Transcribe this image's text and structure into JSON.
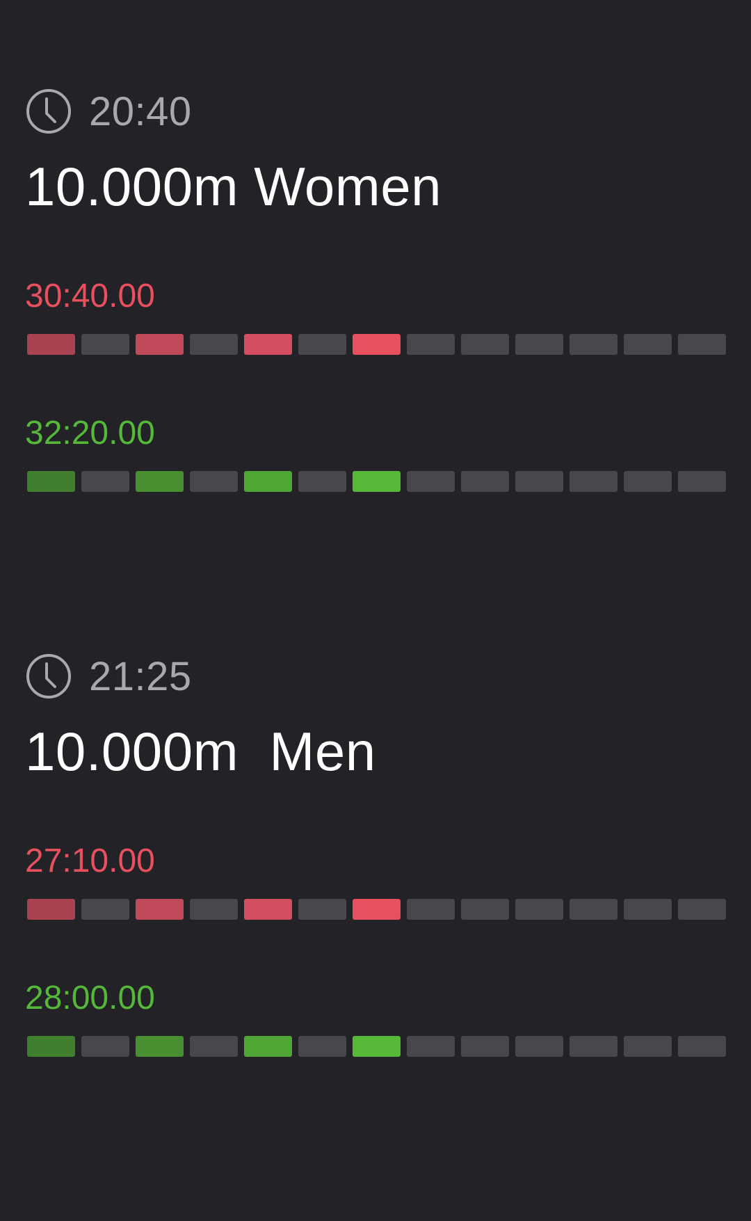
{
  "colors": {
    "background": "#232227",
    "time_text": "#a9a9ad",
    "off_segment": "#48474d",
    "red_text": "#e8505f",
    "green_text": "#55b83b",
    "red_steps": [
      "#a9434f",
      "#c0495a",
      "#d34e5f",
      "#e8505f"
    ],
    "green_steps": [
      "#3f7f2d",
      "#478f30",
      "#4fa635",
      "#58b83a"
    ]
  },
  "icons": {
    "clock": "clock-icon"
  },
  "segments_per_bar": 13,
  "races": [
    {
      "start_time": "20:40",
      "title": "10.000m Women",
      "targets": [
        {
          "color": "red",
          "time": "30:40.00",
          "lit_segments": [
            0,
            2,
            4,
            6
          ]
        },
        {
          "color": "green",
          "time": "32:20.00",
          "lit_segments": [
            0,
            2,
            4,
            6
          ]
        }
      ]
    },
    {
      "start_time": "21:25",
      "title": "10.000m  Men",
      "targets": [
        {
          "color": "red",
          "time": "27:10.00",
          "lit_segments": [
            0,
            2,
            4,
            6
          ]
        },
        {
          "color": "green",
          "time": "28:00.00",
          "lit_segments": [
            0,
            2,
            4,
            6
          ]
        }
      ]
    }
  ]
}
